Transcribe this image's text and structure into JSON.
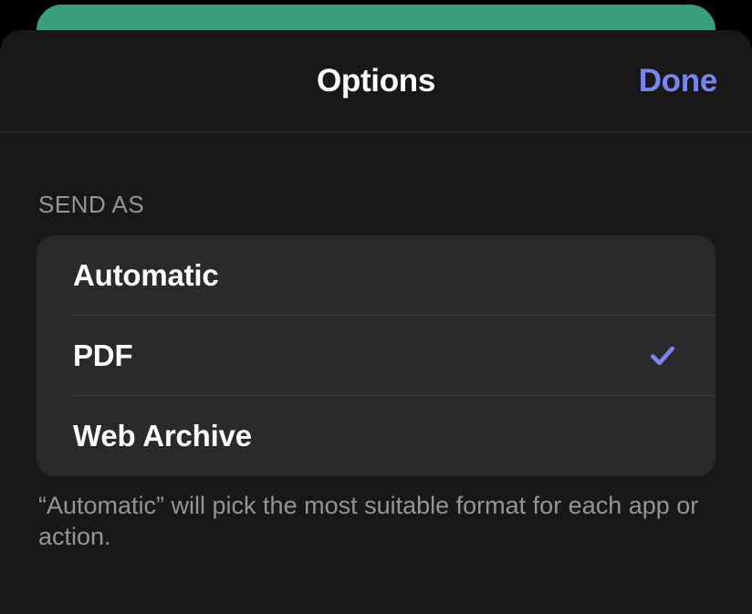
{
  "header": {
    "title": "Options",
    "done_label": "Done"
  },
  "section": {
    "header": "SEND AS",
    "items": [
      {
        "label": "Automatic",
        "selected": false
      },
      {
        "label": "PDF",
        "selected": true
      },
      {
        "label": "Web Archive",
        "selected": false
      }
    ],
    "footer": "“Automatic” will pick the most suitable format for each app or action."
  },
  "colors": {
    "accent": "#7a86ef"
  }
}
